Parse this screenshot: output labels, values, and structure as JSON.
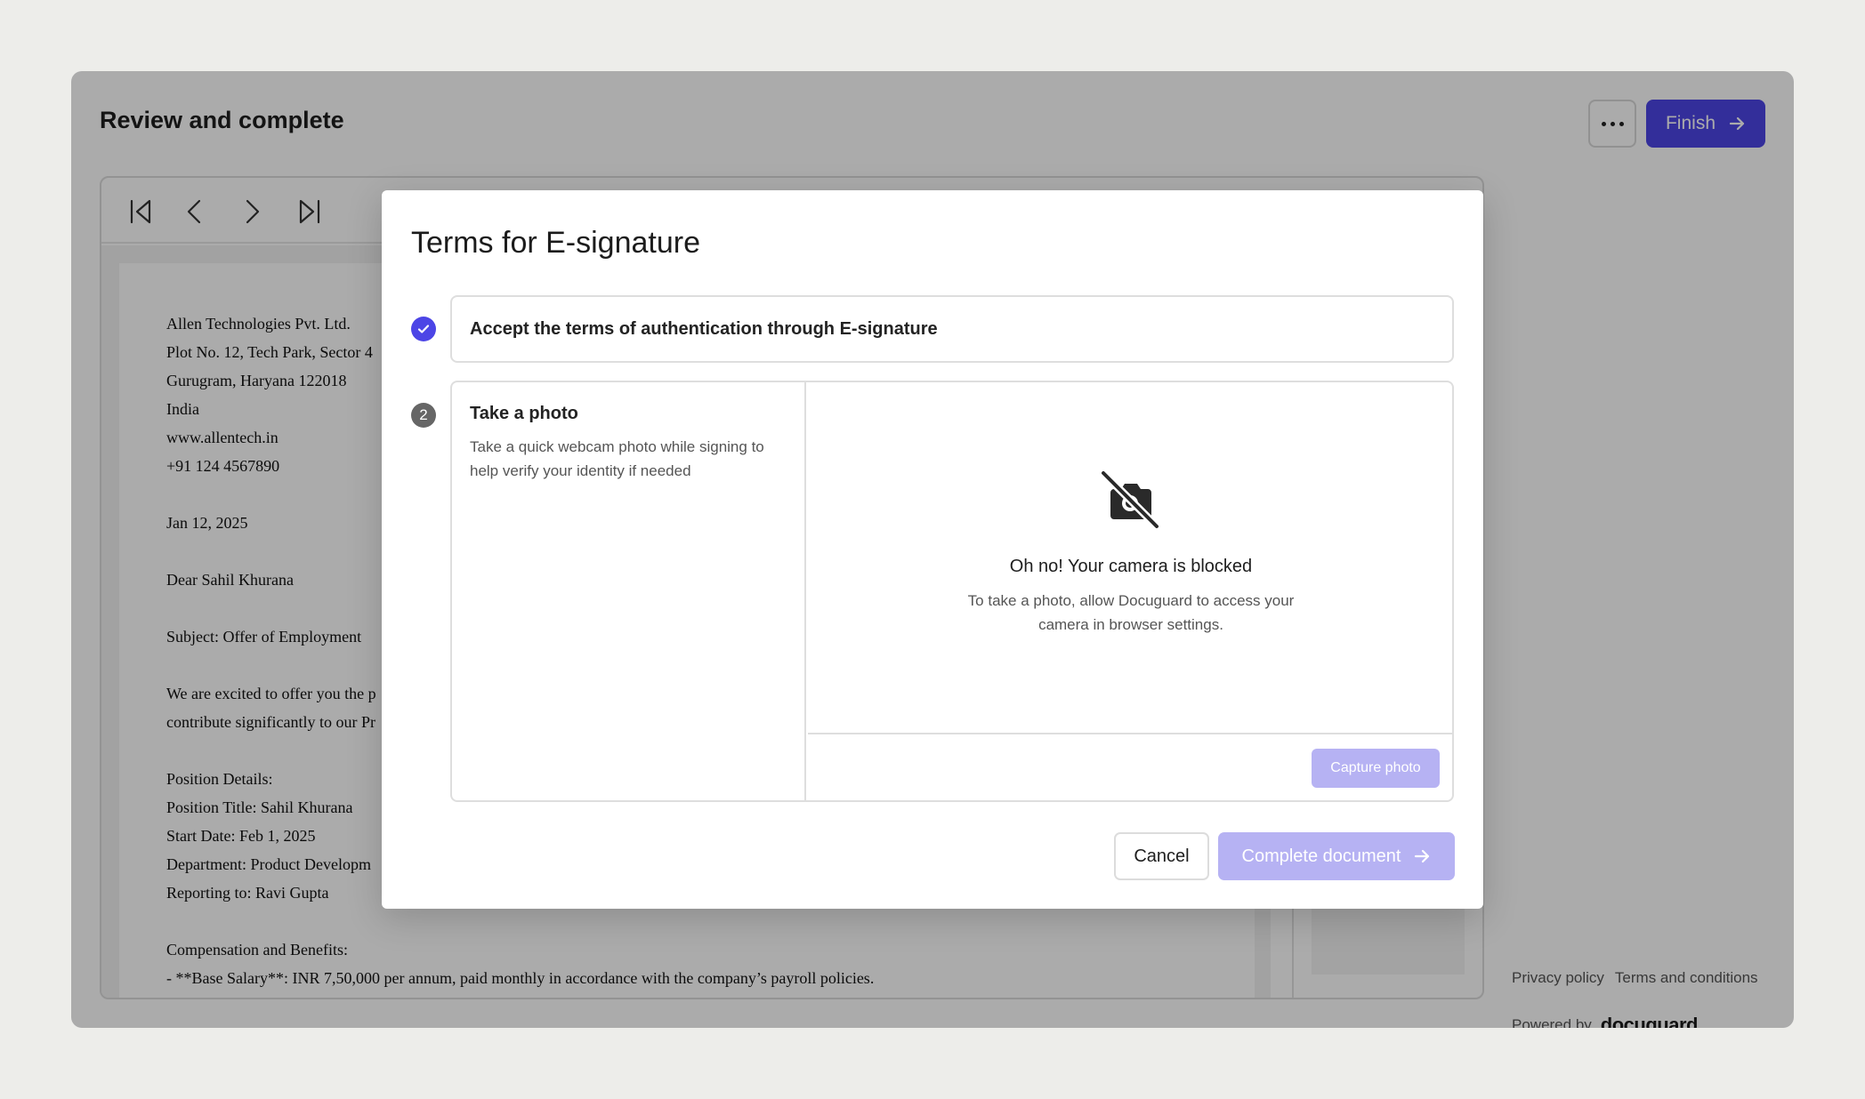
{
  "header": {
    "title": "Review and complete",
    "finish_label": "Finish"
  },
  "document": {
    "lines": [
      "Allen Technologies Pvt. Ltd.",
      "Plot No. 12, Tech Park, Sector 4",
      "Gurugram, Haryana 122018",
      "India",
      "www.allentech.in",
      "+91 124 4567890",
      "",
      "Jan 12, 2025",
      "",
      "Dear Sahil Khurana",
      "",
      "Subject: Offer of Employment",
      "",
      "We are excited to offer you the p",
      "contribute significantly to our Pr",
      "",
      "Position Details:",
      "Position Title: Sahil Khurana",
      "Start Date: Feb 1, 2025",
      "Department: Product Developm",
      "Reporting to: Ravi Gupta",
      "",
      "Compensation and Benefits:",
      "- **Base Salary**: INR 7,50,000 per annum, paid monthly in accordance with the company’s payroll policies."
    ]
  },
  "footer": {
    "privacy_label": "Privacy policy",
    "terms_label": "Terms and conditions",
    "powered_by": "Powered by",
    "brand": "docuguard"
  },
  "modal": {
    "title": "Terms for E-signature",
    "step1": {
      "label": "Accept the terms of authentication through E-signature",
      "status": "completed"
    },
    "step2": {
      "number": "2",
      "heading": "Take a photo",
      "description": "Take a quick webcam photo while signing to help verify your identity if needed",
      "camera_title": "Oh no! Your camera is blocked",
      "camera_desc": "To take a photo, allow Docuguard to access your camera in browser settings.",
      "capture_label": "Capture photo"
    },
    "cancel_label": "Cancel",
    "complete_label": "Complete document"
  },
  "colors": {
    "accent": "#4c45e6",
    "accent_disabled": "#b6b2f3",
    "overlay": "rgba(0,0,0,0.33)"
  },
  "icons": {
    "more": "ellipsis-icon",
    "finish": "arrow-right-icon",
    "first_page": "first-page-icon",
    "prev_page": "chevron-left-icon",
    "next_page": "chevron-right-icon",
    "last_page": "last-page-icon",
    "step_done": "check-icon",
    "camera_blocked": "camera-off-icon"
  }
}
